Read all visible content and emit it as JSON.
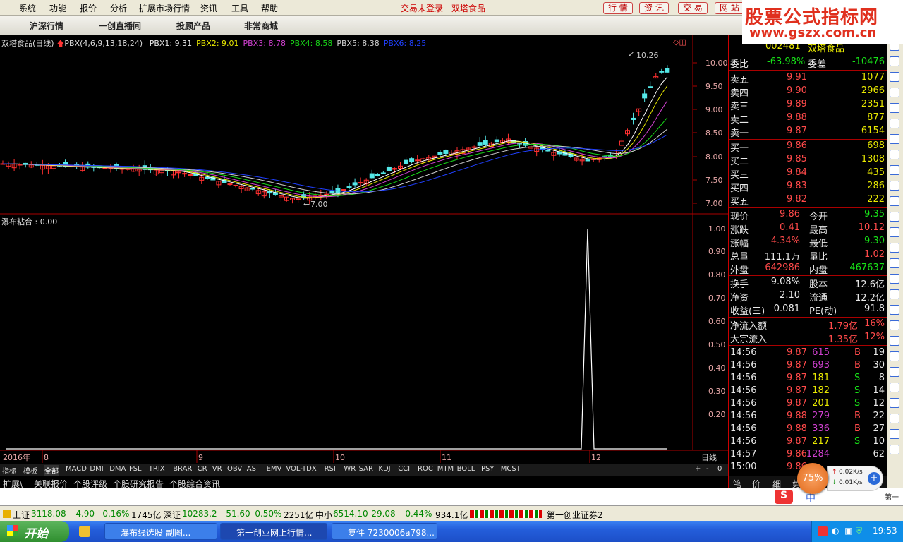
{
  "menu": {
    "items": [
      "系统",
      "功能",
      "报价",
      "分析",
      "扩展市场行情",
      "资讯",
      "工具",
      "帮助"
    ],
    "login_status": "交易未登录",
    "stock_name": "双塔食品",
    "buttons": [
      "行 情",
      "资 讯",
      "交 易",
      "网 站"
    ]
  },
  "toolbar": {
    "items": [
      "沪深行情",
      "一创直播间",
      "投顾产品",
      "非常商城"
    ]
  },
  "watermark": {
    "line1": "股票公式指标网",
    "line2": "www.gszx.com.cn"
  },
  "main_chart": {
    "title": "双塔食品(日线)",
    "indicator": "PBX(4,6,9,13,18,24)",
    "legend": [
      {
        "label": "PBX1: 9.31",
        "color": "#e8e8e8"
      },
      {
        "label": "PBX2: 9.01",
        "color": "#e8e800"
      },
      {
        "label": "PBX3: 8.78",
        "color": "#d040d0"
      },
      {
        "label": "PBX4: 8.58",
        "color": "#18d818"
      },
      {
        "label": "PBX5: 8.38",
        "color": "#cfcfcf"
      },
      {
        "label": "PBX6: 8.25",
        "color": "#2040ff"
      }
    ],
    "y_ticks": [
      "10.00",
      "9.50",
      "9.00",
      "8.50",
      "8.00",
      "7.50",
      "7.00"
    ],
    "high_label": "10.26",
    "low_label": "7.00"
  },
  "sub_chart": {
    "title": "瀑布粘合 : 0.00",
    "y_ticks": [
      "1.00",
      "0.90",
      "0.80",
      "0.70",
      "0.60",
      "0.50",
      "0.40",
      "0.30",
      "0.20"
    ]
  },
  "x_axis": {
    "labels": [
      "2016年",
      "8",
      "9",
      "10",
      "11",
      "12"
    ],
    "period": "日线"
  },
  "chart_data": {
    "type": "line",
    "title": "瀑布粘合",
    "series": [
      {
        "name": "瀑布粘合",
        "values": [
          0,
          0,
          0,
          0,
          0,
          0,
          0,
          0,
          0,
          0,
          0,
          0,
          0,
          0,
          0,
          0,
          0,
          0,
          0,
          0,
          1,
          0,
          0,
          0,
          0,
          0,
          0,
          0,
          0,
          0,
          0,
          0
        ]
      }
    ],
    "ylim": [
      0,
      1
    ],
    "grid": false
  },
  "index_tabs": {
    "left": [
      "指标",
      "模板",
      "全部"
    ],
    "items": [
      "MACD",
      "DMI",
      "DMA",
      "FSL",
      "TRIX",
      "BRAR",
      "CR",
      "VR",
      "OBV",
      "ASI",
      "EMV",
      "VOL-TDX",
      "RSI",
      "WR",
      "SAR",
      "KDJ",
      "CCI",
      "ROC",
      "MTM",
      "BOLL",
      "PSY",
      "MCST"
    ],
    "right": [
      "+",
      "-",
      "0"
    ]
  },
  "sub_tabs": [
    "扩展\\",
    "关联报价",
    "个股评级",
    "个股研究报告",
    "个股综合资讯"
  ],
  "quote": {
    "code": "002481",
    "name": "双塔食品",
    "weibi_label": "委比",
    "weibi": "-63.98%",
    "weicha_label": "委差",
    "weicha": "-10476",
    "sells": [
      {
        "label": "卖五",
        "price": "9.91",
        "vol": "1077"
      },
      {
        "label": "卖四",
        "price": "9.90",
        "vol": "2966"
      },
      {
        "label": "卖三",
        "price": "9.89",
        "vol": "2351"
      },
      {
        "label": "卖二",
        "price": "9.88",
        "vol": "877"
      },
      {
        "label": "卖一",
        "price": "9.87",
        "vol": "6154"
      }
    ],
    "buys": [
      {
        "label": "买一",
        "price": "9.86",
        "vol": "698"
      },
      {
        "label": "买二",
        "price": "9.85",
        "vol": "1308"
      },
      {
        "label": "买三",
        "price": "9.84",
        "vol": "435"
      },
      {
        "label": "买四",
        "price": "9.83",
        "vol": "286"
      },
      {
        "label": "买五",
        "price": "9.82",
        "vol": "222"
      }
    ],
    "stats": [
      {
        "l1": "现价",
        "v1": "9.86",
        "c1": "red",
        "l2": "今开",
        "v2": "9.35",
        "c2": "green"
      },
      {
        "l1": "涨跌",
        "v1": "0.41",
        "c1": "red",
        "l2": "最高",
        "v2": "10.12",
        "c2": "red"
      },
      {
        "l1": "涨幅",
        "v1": "4.34%",
        "c1": "red",
        "l2": "最低",
        "v2": "9.30",
        "c2": "green"
      },
      {
        "l1": "总量",
        "v1": "111.1万",
        "c1": "white",
        "l2": "量比",
        "v2": "1.02",
        "c2": "red"
      },
      {
        "l1": "外盘",
        "v1": "642986",
        "c1": "red",
        "l2": "内盘",
        "v2": "467637",
        "c2": "green"
      }
    ],
    "stats2": [
      {
        "l1": "换手",
        "v1": "9.08%",
        "l2": "股本",
        "v2": "12.6亿"
      },
      {
        "l1": "净资",
        "v1": "2.10",
        "l2": "流通",
        "v2": "12.2亿"
      },
      {
        "l1": "收益(三)",
        "v1": "0.081",
        "l2": "PE(动)",
        "v2": "91.8"
      }
    ],
    "flows": [
      {
        "label": "净流入额",
        "value": "1.79亿",
        "pct": "16%"
      },
      {
        "label": "大宗流入",
        "value": "1.35亿",
        "pct": "12%"
      }
    ],
    "ticks": [
      {
        "t": "14:56",
        "p": "9.87",
        "v": "615",
        "s": "B",
        "n": "19"
      },
      {
        "t": "14:56",
        "p": "9.87",
        "v": "693",
        "s": "B",
        "n": "30"
      },
      {
        "t": "14:56",
        "p": "9.87",
        "v": "181",
        "s": "S",
        "n": "8"
      },
      {
        "t": "14:56",
        "p": "9.87",
        "v": "182",
        "s": "S",
        "n": "14"
      },
      {
        "t": "14:56",
        "p": "9.87",
        "v": "201",
        "s": "S",
        "n": "12"
      },
      {
        "t": "14:56",
        "p": "9.88",
        "v": "279",
        "s": "B",
        "n": "22"
      },
      {
        "t": "14:56",
        "p": "9.88",
        "v": "336",
        "s": "B",
        "n": "27"
      },
      {
        "t": "14:56",
        "p": "9.87",
        "v": "217",
        "s": "S",
        "n": "10"
      },
      {
        "t": "14:57",
        "p": "9.86",
        "v": "1284",
        "s": "",
        "n": "62"
      },
      {
        "t": "15:00",
        "p": "9.86",
        "v": "",
        "s": "",
        "n": ""
      }
    ],
    "bottom_tabs": [
      "笔",
      "价",
      "细",
      "势"
    ]
  },
  "badge": {
    "pct": "75%",
    "up": "0.02K/s",
    "down": "0.01K/s"
  },
  "status": {
    "sh_label": "上证",
    "sh_val": "3118.08",
    "sh_chg": "-4.90",
    "sh_pct": "-0.16%",
    "sh_amt": "1745亿",
    "sz_label": "深证",
    "sz_val": "10283.2",
    "sz_chg": "-51.60",
    "sz_pct": "-0.50%",
    "sz_amt": "2251亿",
    "zx_label": "中小",
    "zx_val": "6514.10",
    "zx_chg": "-29.08",
    "zx_pct": "-0.44%",
    "zx_amt": "934.1亿",
    "broker": "第一创业证券2"
  },
  "taskbar": {
    "start": "开始",
    "tasks": [
      "瀑布线选股 副图...",
      "第一创业网上行情...",
      "复件 7230006a798..."
    ],
    "ime": "中",
    "clock": "19:53",
    "corner": "第一"
  }
}
